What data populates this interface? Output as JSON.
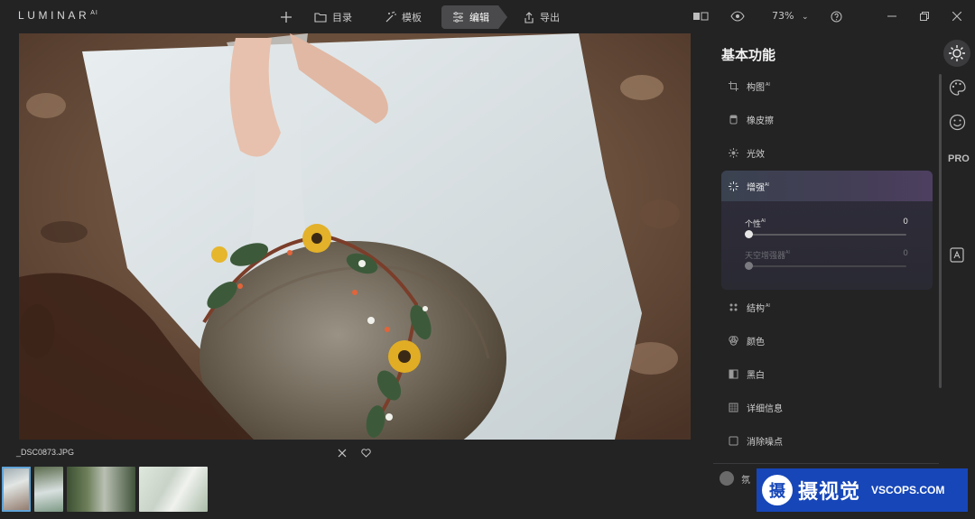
{
  "brand": {
    "name": "LUMINAR",
    "sup": "AI"
  },
  "toolbar": {
    "catalog_label": "目录",
    "templates_label": "模板",
    "edit_label": "编辑",
    "export_label": "导出",
    "zoom": "73%"
  },
  "image": {
    "filename": "_DSC0873.JPG"
  },
  "panel": {
    "title": "基本功能",
    "tools": [
      {
        "label": "构图",
        "ai": "AI"
      },
      {
        "label": "橡皮擦",
        "ai": ""
      },
      {
        "label": "光效",
        "ai": ""
      },
      {
        "label": "结构",
        "ai": "AI"
      },
      {
        "label": "颜色",
        "ai": ""
      },
      {
        "label": "黑白",
        "ai": ""
      },
      {
        "label": "详细信息",
        "ai": ""
      },
      {
        "label": "消除噪点",
        "ai": ""
      }
    ],
    "enhance": {
      "label": "增强",
      "ai": "AI",
      "sliders": [
        {
          "label": "个性",
          "ai": "AI",
          "value": "0",
          "level": 0,
          "enabled": true
        },
        {
          "label": "天空增强器",
          "ai": "AI",
          "value": "0",
          "level": 0,
          "enabled": false
        }
      ]
    },
    "partial_label": "氛"
  },
  "rail": {
    "pro_label": "PRO"
  },
  "watermark": {
    "cn": "摄视觉",
    "en": "VSCOPS.COM",
    "logo_char": "摄"
  },
  "colors": {
    "accent": "#5fa4d8",
    "enhance_grad": "#433e55",
    "watermark_bg": "#1646b8"
  }
}
